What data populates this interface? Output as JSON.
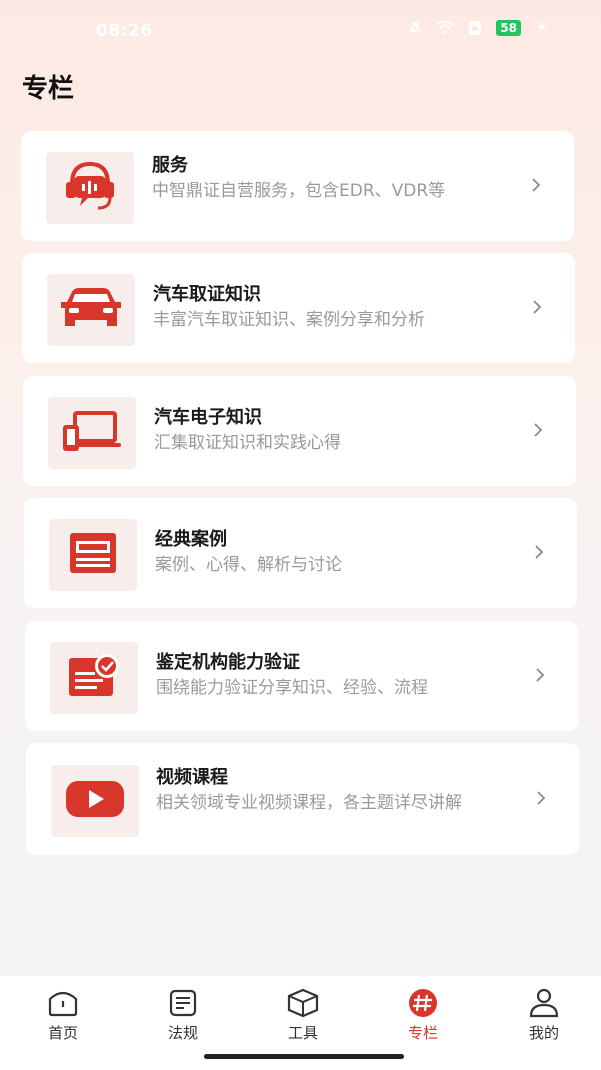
{
  "status_bar": {
    "time": "08:26",
    "battery": "58"
  },
  "page": {
    "title": "专栏"
  },
  "cards": [
    {
      "title": "服务",
      "desc": "中智鼎证自营服务，包含EDR、VDR等",
      "icon": "headset-icon"
    },
    {
      "title": "汽车取证知识",
      "desc": "丰富汽车取证知识、案例分享和分析",
      "icon": "car-icon"
    },
    {
      "title": "汽车电子知识",
      "desc": "汇集取证知识和实践心得",
      "icon": "devices-icon"
    },
    {
      "title": "经典案例",
      "desc": "案例、心得、解析与讨论",
      "icon": "case-icon"
    },
    {
      "title": "鉴定机构能力验证",
      "desc": "围绕能力验证分享知识、经验、流程",
      "icon": "certificate-icon"
    },
    {
      "title": "视频课程",
      "desc": "相关领域专业视频课程，各主题详尽讲解",
      "icon": "video-play-icon"
    }
  ],
  "tabs": [
    {
      "label": "首页",
      "icon": "home-icon",
      "active": false
    },
    {
      "label": "法规",
      "icon": "document-icon",
      "active": false
    },
    {
      "label": "工具",
      "icon": "box-icon",
      "active": false
    },
    {
      "label": "专栏",
      "icon": "hash-icon",
      "active": true
    },
    {
      "label": "我的",
      "icon": "user-icon",
      "active": false
    }
  ],
  "colors": {
    "accent": "#d9362b",
    "icon_bg": "#f7eeeb",
    "desc_text": "#9a9a9a"
  }
}
